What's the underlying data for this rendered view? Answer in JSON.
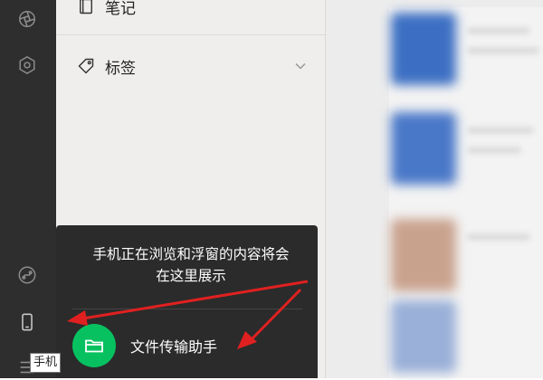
{
  "sidebar_rail": {
    "icons": [
      "moments-icon",
      "mini-program-icon",
      "channels-link-icon",
      "phone-icon",
      "menu-icon"
    ],
    "icon_color": "#8d8d8d",
    "active_icon_color": "#ffffff"
  },
  "favorites_panel": {
    "items": [
      {
        "label": "笔记",
        "icon": "note-icon"
      },
      {
        "label": "标签",
        "icon": "tag-icon"
      }
    ]
  },
  "popup": {
    "message_line1": "手机正在浏览和浮窗的内容将会",
    "message_line2": "在这里展示",
    "contact_name": "文件传输助手",
    "contact_icon": "folder-icon",
    "contact_color": "#07c160"
  },
  "tooltip": {
    "text": "手机"
  },
  "annotation": {
    "arrow_color": "#e02020"
  }
}
